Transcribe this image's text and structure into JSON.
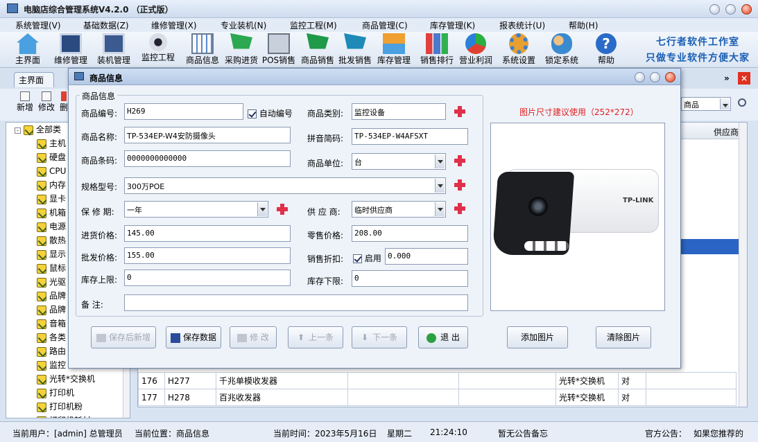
{
  "app": {
    "title": "电脑店综合管理系统V4.2.0 （正式版）"
  },
  "menu": [
    "系统管理(V)",
    "基础数据(Z)",
    "维修管理(X)",
    "专业装机(N)",
    "监控工程(M)",
    "商品管理(C)",
    "库存管理(K)",
    "报表统计(U)",
    "帮助(H)"
  ],
  "toolbar": {
    "items": [
      "主界面",
      "维修管理",
      "装机管理",
      "监控工程",
      "商品信息",
      "采购进货",
      "POS销售",
      "商品销售",
      "批发销售",
      "库存管理",
      "销售排行",
      "营业利润",
      "系统设置",
      "锁定系统",
      "帮助"
    ],
    "slogan1": "七行者软件工作室",
    "slogan2": "只做专业软件方便大家"
  },
  "tabs": {
    "main": "主界面"
  },
  "subtoolbar": {
    "new": "新增",
    "edit": "修改",
    "del": "删",
    "search_field": "商品"
  },
  "tree": {
    "root": "全部类",
    "items": [
      "主机",
      "硬盘",
      "CPU",
      "内存",
      "显卡",
      "机箱",
      "电源",
      "散热",
      "显示",
      "鼠标",
      "光驱",
      "品牌",
      "品牌",
      "音箱",
      "各类",
      "路由",
      "监控",
      "光转*交换机",
      "打印机",
      "打印机粉",
      "打印机耗材"
    ]
  },
  "grid": {
    "headers": [
      "",
      "供应商"
    ],
    "rows": [
      {
        "no": "176",
        "code": "H277",
        "name": "千兆单模收发器",
        "cat": "光转*交换机",
        "flag": "对"
      },
      {
        "no": "177",
        "code": "H278",
        "name": "百兆收发器",
        "cat": "光转*交换机",
        "flag": "对"
      }
    ]
  },
  "dialog": {
    "title": "商品信息",
    "group": "商品信息",
    "code_label": "商品编号:",
    "code": "H269",
    "auto_code": "自动编号",
    "category_label": "商品类别:",
    "category": "监控设备",
    "name_label": "商品名称:",
    "name": "TP-534EP-W4安防摄像头",
    "pinyin_label": "拼音简码:",
    "pinyin": "TP-534EP-W4AFSXT",
    "barcode_label": "商品条码:",
    "barcode": "0000000000000",
    "unit_label": "商品单位:",
    "unit": "台",
    "spec_label": "规格型号:",
    "spec": "300万POE",
    "warranty_label": "保 修 期:",
    "warranty": "一年",
    "supplier_label": "供 应 商:",
    "supplier": "临时供应商",
    "cost_label": "进货价格:",
    "cost": "145.00",
    "retail_label": "零售价格:",
    "retail": "208.00",
    "wholesale_label": "批发价格:",
    "wholesale": "155.00",
    "discount_label": "销售折扣:",
    "discount_enable": "启用",
    "discount": "0.000",
    "max_label": "库存上限:",
    "max": "0",
    "min_label": "库存下限:",
    "min": "0",
    "note_label": "备    注:",
    "note": "",
    "image_hint": "图片尺寸建议使用（252*272）",
    "brand": "TP-LINK",
    "buttons": {
      "save_new": "保存后新增",
      "save": "保存数据",
      "edit": "修 改",
      "prev": "上一条",
      "next": "下一条",
      "exit": "退 出",
      "add_image": "添加图片",
      "clear_image": "清除图片"
    }
  },
  "status": {
    "user": "当前用户：[admin] 总管理员",
    "position": "当前位置：商品信息",
    "time": "当前时间：2023年5月16日",
    "weekday": "星期二",
    "clock": "21:24:10",
    "notice": "暂无公告备忘",
    "official": "官方公告：",
    "official_text": "如果您推荐的"
  }
}
